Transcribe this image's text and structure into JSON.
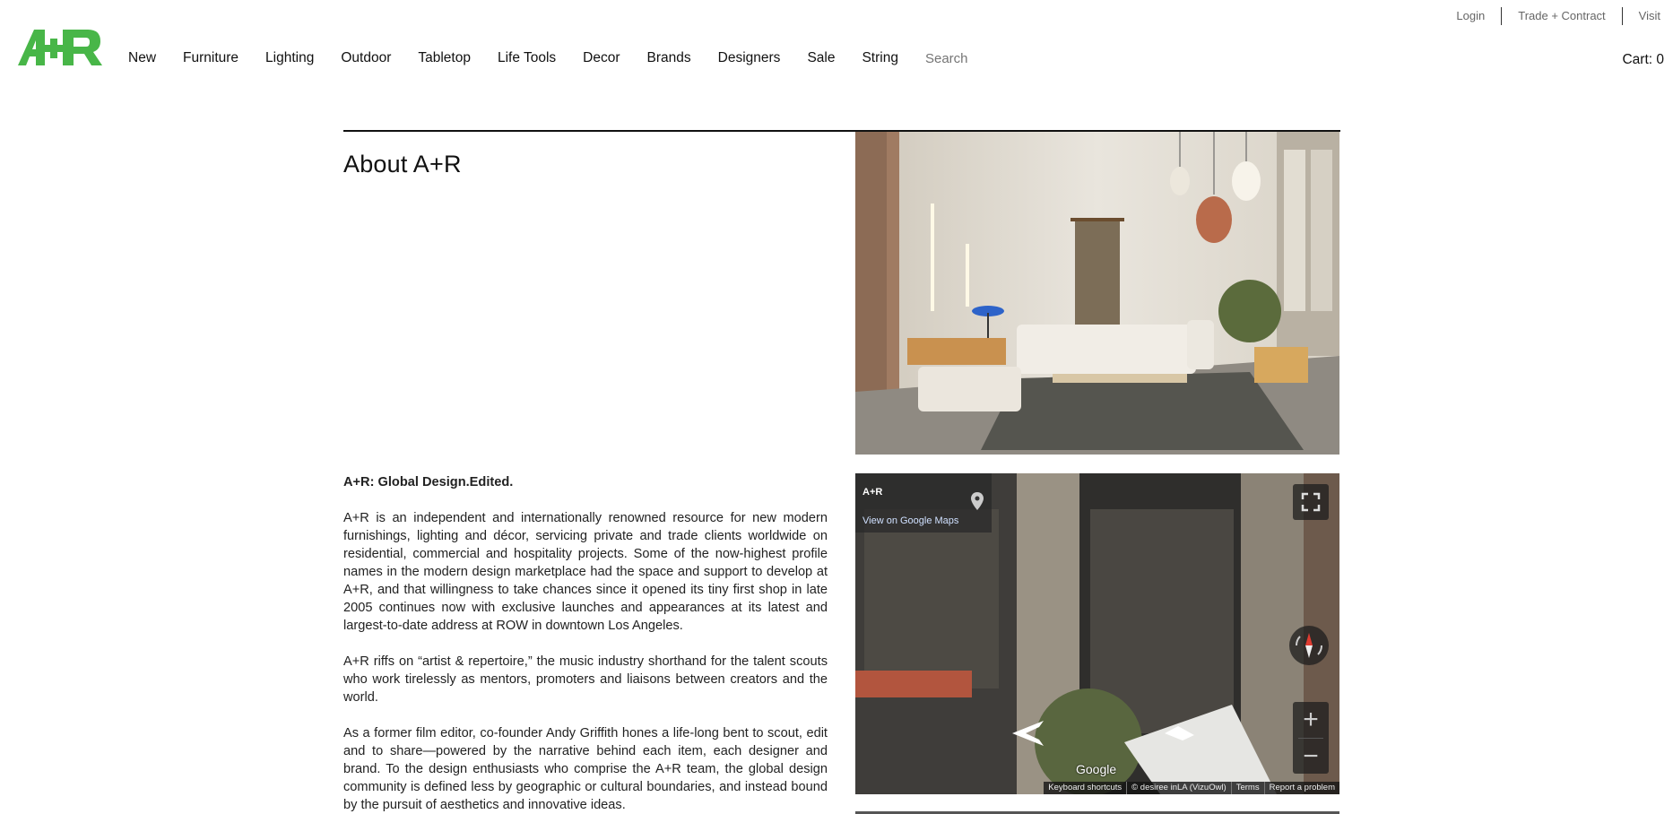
{
  "utility": {
    "login": "Login",
    "trade": "Trade + Contract",
    "visit": "Visit"
  },
  "header": {
    "logo_text": "A+R",
    "nav": [
      "New",
      "Furniture",
      "Lighting",
      "Outdoor",
      "Tabletop",
      "Life Tools",
      "Decor",
      "Brands",
      "Designers",
      "Sale",
      "String"
    ],
    "search_placeholder": "Search",
    "cart": "Cart: 0"
  },
  "colors": {
    "brand_green": "#48b648",
    "rule": "#111111"
  },
  "page": {
    "title": "About A+R",
    "tagline": "A+R: Global Design.Edited.",
    "paragraphs": [
      "A+R is an independent and internationally renowned resource for new modern furnishings, lighting and décor, servicing private and trade clients worldwide on residential, commercial and hospitality projects. Some of the now-highest profile names in the modern design marketplace had the space and support to develop at A+R, and that willingness to take chances since it opened its tiny first shop in late 2005 continues now with exclusive launches and appearances at its latest and largest-to-date address at ROW in downtown Los Angeles.",
      "A+R riffs on “artist & repertoire,” the music industry shorthand for the talent scouts who work tirelessly as mentors, promoters and liaisons between creators and the world.",
      "As a former film editor, co-founder Andy Griffith hones a life-long bent to scout, edit and to share—powered by the narrative behind each item, each designer and brand. To the design enthusiasts who comprise the A+R team, the global design community is defined less by geographic or cultural boundaries, and instead bound by the pursuit of aesthetics and innovative ideas."
    ]
  },
  "streetview": {
    "place": "A+R",
    "link": "View on Google Maps",
    "google_label": "Google",
    "footer": [
      "Keyboard shortcuts",
      "© desiree inLA (VizuOwl)",
      "Terms",
      "Report a problem"
    ]
  }
}
